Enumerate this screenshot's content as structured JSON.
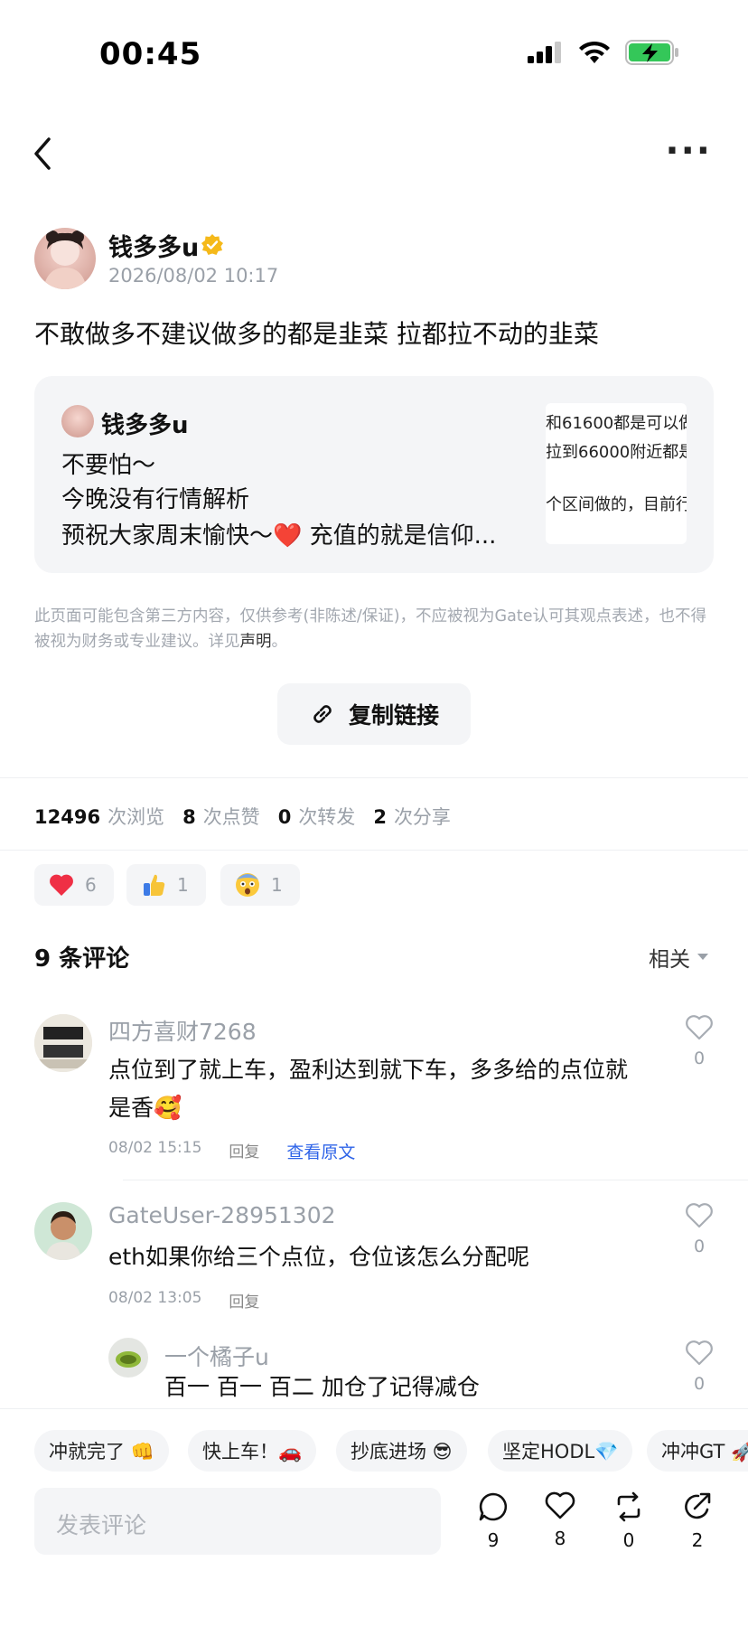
{
  "status_bar": {
    "time": "00:45"
  },
  "post": {
    "author": "钱多多u",
    "timestamp": "2026/08/02 10:17",
    "text": "不敢做多不建议做多的都是韭菜 拉都拉不动的韭菜",
    "quote": {
      "author": "钱多多u",
      "lines": [
        "不要怕～",
        "今晚没有行情解析",
        "预祝大家周末愉快～❤️  充值的就是信仰..."
      ],
      "thumbnail_lines": [
        "和61600都是可以做",
        "拉到66000附近都是",
        "个区间做的，目前行"
      ]
    },
    "disclaimer": "此页面可能包含第三方内容，仅供参考(非陈述/保证)，不应被视为Gate认可其观点表述，也不得被视为财务或专业建议。详见",
    "disclaimer_link": "声明",
    "disclaimer_end": "。",
    "copy_link_label": "复制链接"
  },
  "stats": [
    {
      "value": "12496",
      "label": "次浏览"
    },
    {
      "value": "8",
      "label": "次点赞"
    },
    {
      "value": "0",
      "label": "次转发"
    },
    {
      "value": "2",
      "label": "次分享"
    }
  ],
  "reactions": [
    {
      "icon": "red-heart-icon",
      "count": "6"
    },
    {
      "icon": "thumbs-up-icon",
      "count": "1"
    },
    {
      "icon": "shocked-face-icon",
      "count": "1"
    }
  ],
  "comments_header": {
    "title": "9 条评论",
    "sort": "相关"
  },
  "comments": [
    {
      "user": "四方喜财7268",
      "text_line1": "点位到了就上车，盈利达到就下车，多多给的点位就",
      "text_line2": "是香🥰",
      "time": "08/02 15:15",
      "reply": "回复",
      "view_original": "查看原文",
      "likes": "0"
    },
    {
      "user": "GateUser-28951302",
      "text": "eth如果你给三个点位，仓位该怎么分配呢",
      "time": "08/02 13:05",
      "reply": "回复",
      "likes": "0"
    },
    {
      "user": "一个橘子u",
      "text": "百一  百一  百二    加仓了记得减仓",
      "likes": "0"
    }
  ],
  "quick_replies": [
    "冲就完了 👊",
    "快上车！🚗",
    "抄底进场 😎",
    "坚定HODL💎",
    "冲冲GT 🚀"
  ],
  "comment_input": {
    "placeholder": "发表评论"
  },
  "actions": [
    {
      "icon": "comment-icon",
      "count": "9"
    },
    {
      "icon": "heart-outline-icon",
      "count": "8"
    },
    {
      "icon": "repost-icon",
      "count": "0"
    },
    {
      "icon": "share-icon",
      "count": "2"
    }
  ]
}
